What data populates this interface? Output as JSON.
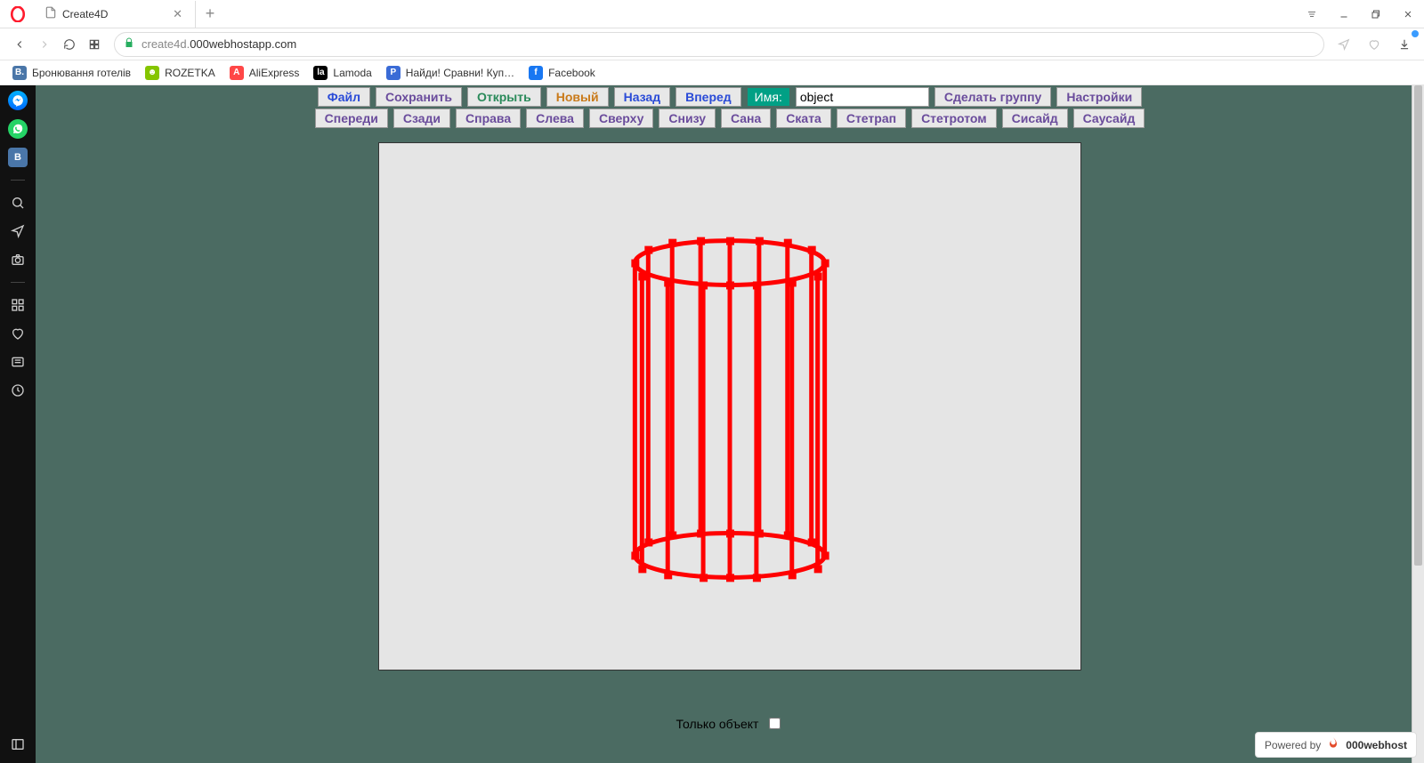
{
  "browser": {
    "tab_title": "Create4D",
    "url_prefix": "create4d.",
    "url_domain": "000webhostapp.com",
    "bookmarks": [
      {
        "label": "Бронювання готелів",
        "icon_bg": "#4a76a8",
        "icon_text": "B."
      },
      {
        "label": "ROZETKA",
        "icon_bg": "#85c500",
        "icon_text": "☻"
      },
      {
        "label": "AliExpress",
        "icon_bg": "#ff4747",
        "icon_text": "A"
      },
      {
        "label": "Lamoda",
        "icon_bg": "#000",
        "icon_text": "la"
      },
      {
        "label": "Найди! Сравни! Куп…",
        "icon_bg": "#3a6bd6",
        "icon_text": "P"
      },
      {
        "label": "Facebook",
        "icon_bg": "#1877f2",
        "icon_text": "f"
      }
    ]
  },
  "toolbar1": {
    "file": "Файл",
    "save": "Сохранить",
    "open": "Открыть",
    "new": "Новый",
    "back": "Назад",
    "forward": "Вперед",
    "name_label": "Имя:",
    "name_value": "object",
    "make_group": "Сделать группу",
    "settings": "Настройки"
  },
  "toolbar2": {
    "front": "Спереди",
    "back": "Сзади",
    "right": "Справа",
    "left": "Слева",
    "top": "Сверху",
    "bottom": "Снизу",
    "sana": "Сана",
    "skata": "Ската",
    "stetrap": "Стетрап",
    "stetrotom": "Стетротом",
    "siside": "Сисайд",
    "sauside": "Саусайд"
  },
  "footer": {
    "only_object": "Только объект",
    "powered_by": "Powered by",
    "host_name": "000webhost"
  }
}
